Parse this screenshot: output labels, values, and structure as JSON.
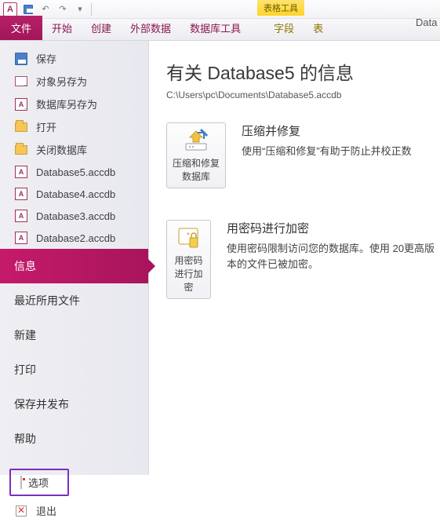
{
  "titlebar": {
    "app_letter": "A",
    "context_tab_title": "表格工具",
    "right_text": "Data"
  },
  "ribbon": {
    "file": "文件",
    "home": "开始",
    "create": "创建",
    "external": "外部数据",
    "dbtools": "数据库工具",
    "field": "字段",
    "table": "表"
  },
  "sidebar": {
    "save": "保存",
    "save_obj_as": "对象另存为",
    "save_db_as": "数据库另存为",
    "open": "打开",
    "close_db": "关闭数据库",
    "recent_files": [
      "Database5.accdb",
      "Database4.accdb",
      "Database3.accdb",
      "Database2.accdb"
    ],
    "info": "信息",
    "recent": "最近所用文件",
    "new": "新建",
    "print": "打印",
    "save_publish": "保存并发布",
    "help": "帮助",
    "options": "选项",
    "exit": "退出"
  },
  "main": {
    "title": "有关 Database5 的信息",
    "path": "C:\\Users\\pc\\Documents\\Database5.accdb",
    "actions": [
      {
        "button": "压缩和修复数据库",
        "heading": "压缩并修复",
        "desc": "使用“压缩和修复”有助于防止并校正数"
      },
      {
        "button": "用密码进行加密",
        "heading": "用密码进行加密",
        "desc": "使用密码限制访问您的数据库。使用 20更高版本的文件已被加密。"
      }
    ]
  }
}
